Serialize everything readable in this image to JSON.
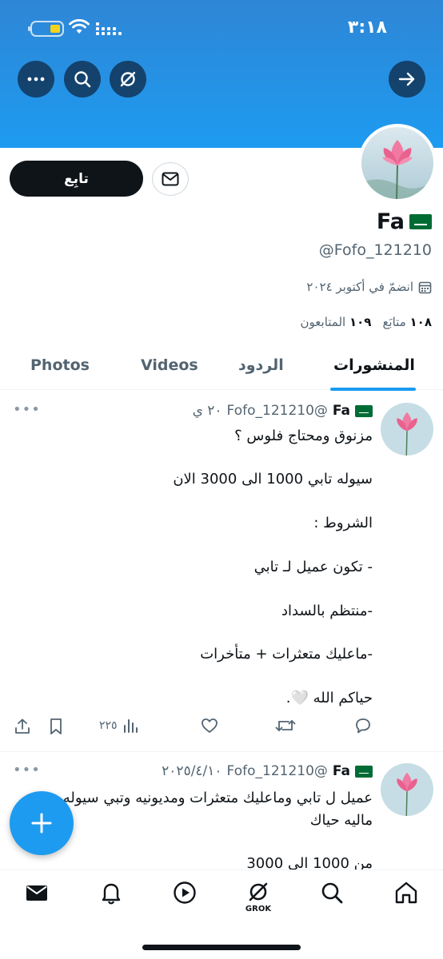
{
  "status_bar": {
    "time": "٣:١٨"
  },
  "header": {
    "back_icon": "arrow-right-icon",
    "grok_icon": "grok-icon",
    "search_icon": "search-icon",
    "more_icon": "more-icon"
  },
  "profile": {
    "name": "Fa",
    "handle": "@Fofo_121210",
    "joined": "انضمّ في أكتوبر ٢٠٢٤",
    "following_count": "١٠٨",
    "following_label": "متابَع",
    "followers_count": "١٠٩",
    "followers_label": "المتابعون",
    "follow_button": "تابِع"
  },
  "tabs": [
    {
      "label": "المنشورات",
      "active": true
    },
    {
      "label": "الردود",
      "active": false
    },
    {
      "label": "Videos",
      "active": false
    },
    {
      "label": "Photos",
      "active": false
    }
  ],
  "posts": [
    {
      "name": "Fa",
      "handle": "@Fofo_121210",
      "time": "٢٠ ي",
      "lines": [
        "مزنوق ومحتاج فلوس ؟",
        "سيوله تابي 1000 الى 3000 الان",
        "الشروط :",
        "- تكون عميل لـ تابي",
        "-منتظم بالسداد",
        "-ماعليك متعثرات + متأخرات",
        "حياكم الله 🤍."
      ],
      "views": "٢٢٥"
    },
    {
      "name": "Fa",
      "handle": "@Fofo_121210",
      "time": "٢٠٢٥/٤/١٠",
      "lines": [
        "عميل ل تابي وماعليك متعثرات ومديونيه وتبي سيوله",
        "ماليه حياك",
        "من 1000 الى 3000"
      ]
    }
  ],
  "bottom_nav": {
    "items": [
      "home-icon",
      "search-icon",
      "grok-icon",
      "play-icon",
      "bell-icon",
      "mail-icon"
    ],
    "grok_label": "GROK"
  },
  "colors": {
    "accent": "#1d9bf0",
    "text": "#0f1419",
    "muted": "#536471",
    "flag": "#006c35"
  }
}
